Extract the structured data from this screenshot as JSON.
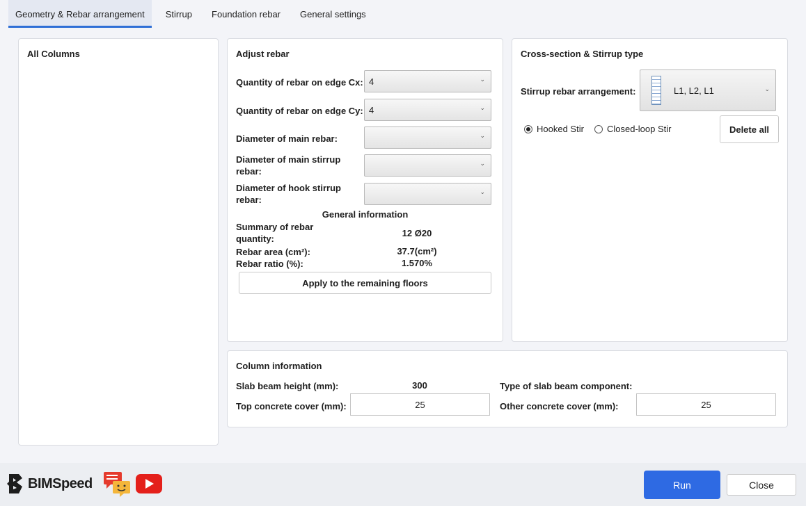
{
  "tabs": [
    {
      "label": "Geometry & Rebar arrangement"
    },
    {
      "label": "Stirrup"
    },
    {
      "label": "Foundation rebar"
    },
    {
      "label": "General settings"
    }
  ],
  "columns_panel": {
    "title": "All Columns"
  },
  "adjust_rebar": {
    "title": "Adjust rebar",
    "qty_cx_label": "Quantity of rebar on edge Cx:",
    "qty_cx_value": "4",
    "qty_cy_label": "Quantity of rebar on edge Cy:",
    "qty_cy_value": "4",
    "main_diam_label": "Diameter of main rebar:",
    "main_diam_value": "",
    "main_stirrup_label_1": "Diameter of main stirrup",
    "main_stirrup_label_2": "rebar:",
    "main_stirrup_value": "",
    "hook_stirrup_label_1": "Diameter of hook stirrup",
    "hook_stirrup_label_2": "rebar:",
    "hook_stirrup_value": "",
    "general_info_title": "General information",
    "summary_label_1": "Summary of rebar",
    "summary_label_2": "quantity:",
    "summary_value": "12 Ø20",
    "area_label": "Rebar area (cm²):",
    "area_value": "37.7(cm²)",
    "ratio_label": "Rebar ratio (%):",
    "ratio_value": "1.570%",
    "apply_button": "Apply to the remaining floors"
  },
  "cross_section": {
    "title": "Cross-section & Stirrup type",
    "stirrup_label": "Stirrup rebar arrangement:",
    "stirrup_value": "L1, L2, L1",
    "hooked_label": "Hooked Stir",
    "closed_label": "Closed-loop Stir",
    "hooked_selected": true,
    "delete_button": "Delete all"
  },
  "column_info": {
    "title": "Column information",
    "slab_height_label": "Slab beam height (mm):",
    "slab_height_value": "300",
    "slab_type_label": "Type of slab beam component:",
    "slab_type_value": "",
    "top_cover_label": "Top concrete cover (mm):",
    "top_cover_value": "25",
    "other_cover_label": "Other concrete cover (mm):",
    "other_cover_value": "25"
  },
  "footer": {
    "brand": "BIMSpeed",
    "run_button": "Run",
    "close_button": "Close",
    "accent_color": "#2e6ae3",
    "icons": [
      "bimspeed-logo-icon",
      "chat-feedback-icon",
      "youtube-icon"
    ]
  }
}
